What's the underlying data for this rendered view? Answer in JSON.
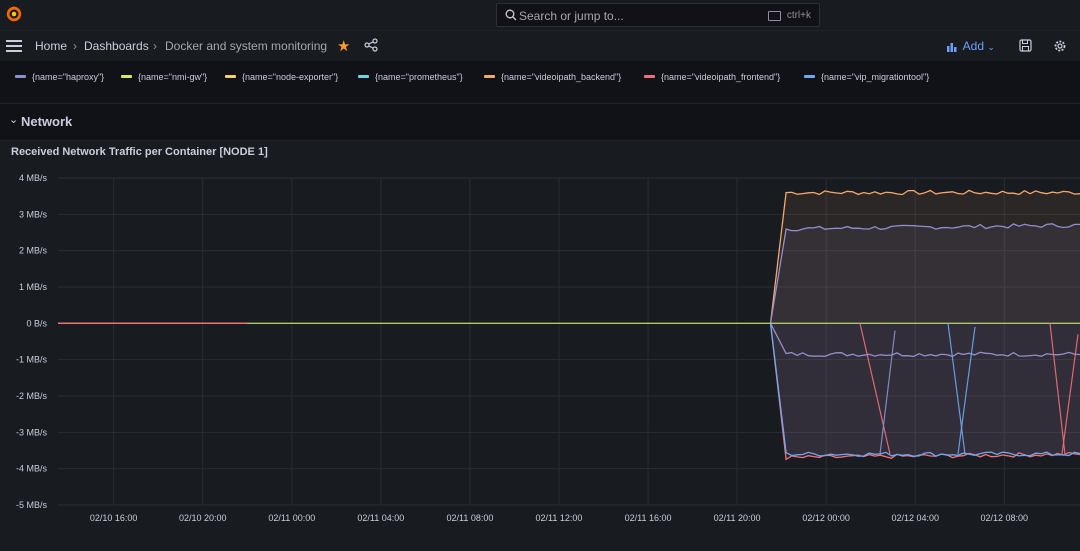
{
  "search": {
    "placeholder": "Search or jump to...",
    "shortcut": "ctrl+k"
  },
  "breadcrumb": {
    "home": "Home",
    "dashboards": "Dashboards",
    "current": "Docker and system monitoring"
  },
  "toolbar": {
    "add_label": "Add"
  },
  "legend": [
    {
      "label": "{name=\"haproxy\"}",
      "color": "#8f8fd0"
    },
    {
      "label": "{name=\"nmi-gw\"}",
      "color": "#d6e86a"
    },
    {
      "label": "{name=\"node-exporter\"}",
      "color": "#f2d06a"
    },
    {
      "label": "{name=\"prometheus\"}",
      "color": "#6fd3e8"
    },
    {
      "label": "{name=\"videoipath_backend\"}",
      "color": "#f5a86a"
    },
    {
      "label": "{name=\"videoipath_frontend\"}",
      "color": "#f07078"
    },
    {
      "label": "{name=\"vip_migrationtool\"}",
      "color": "#6ea8f0"
    }
  ],
  "row": {
    "title": "Network"
  },
  "panel": {
    "title": "Received Network Traffic per Container [NODE 1]"
  },
  "chart_data": {
    "type": "line",
    "title": "Received Network Traffic per Container [NODE 1]",
    "y_ticks": [
      "4 MB/s",
      "3 MB/s",
      "2 MB/s",
      "1 MB/s",
      "0 B/s",
      "-1 MB/s",
      "-2 MB/s",
      "-3 MB/s",
      "-4 MB/s",
      "-5 MB/s"
    ],
    "x_ticks": [
      "02/10 16:00",
      "02/10 20:00",
      "02/11 00:00",
      "02/11 04:00",
      "02/11 08:00",
      "02/11 12:00",
      "02/11 16:00",
      "02/11 20:00",
      "02/12 00:00",
      "02/12 04:00",
      "02/12 08:00"
    ],
    "ylim": [
      -5,
      4
    ],
    "x_hours": [
      -2,
      10
    ],
    "tick_hours": [
      -8,
      -4,
      0,
      4,
      8,
      12,
      16,
      20,
      24,
      28,
      32
    ],
    "xlim_hours": [
      -10.5,
      35.4
    ],
    "grid": true,
    "series": [
      {
        "name": "{name=\"videoipath_backend\"}",
        "color": "#f5a86a",
        "x_hours": [
          21.5,
          22.2,
          35.4
        ],
        "values": [
          0,
          3.6,
          3.6
        ],
        "fill": true
      },
      {
        "name": "{name=\"haproxy\"}",
        "color": "#8f8fd0",
        "x_hours": [
          21.5,
          22.2,
          35.4
        ],
        "values": [
          0,
          2.6,
          2.7
        ],
        "fill": true
      },
      {
        "name": "{name=\"haproxy\"}",
        "color": "#8f8fd0",
        "x_hours": [
          21.5,
          22.2,
          35.4
        ],
        "values": [
          0,
          -0.85,
          -0.85
        ],
        "fill": false
      },
      {
        "name": "{name=\"videoipath_frontend\"}",
        "color": "#f07078",
        "x_hours": [
          21.5,
          22.2,
          35.4
        ],
        "values": [
          0,
          -3.7,
          -3.6
        ],
        "fill": true
      },
      {
        "name": "{name=\"vip_migrationtool\"}",
        "color": "#6ea8f0",
        "x_hours": [
          21.5,
          22.2,
          35.4
        ],
        "values": [
          0,
          -3.6,
          -3.6
        ],
        "fill": true
      },
      {
        "name": "{name=\"nmi-gw\"}",
        "color": "#a8c96a",
        "x_hours": [
          -10.5,
          35.4
        ],
        "values": [
          0,
          0
        ],
        "fill": false
      },
      {
        "name": "{name=\"videoipath_frontend\"}",
        "color": "#f07078",
        "x_hours": [
          -10.5,
          -2
        ],
        "values": [
          0,
          0
        ],
        "fill": false
      }
    ]
  },
  "colors": {
    "bg": "#111217",
    "panel": "#181b1f",
    "grid": "#2a2d33",
    "accent": "#ff9830",
    "link": "#6e9fff"
  },
  "icons": [
    "grafana-logo-icon",
    "search-icon",
    "keyboard-icon",
    "menu-icon",
    "star-icon",
    "share-icon",
    "add-panel-icon",
    "save-icon",
    "settings-icon",
    "chevron-down-icon"
  ]
}
